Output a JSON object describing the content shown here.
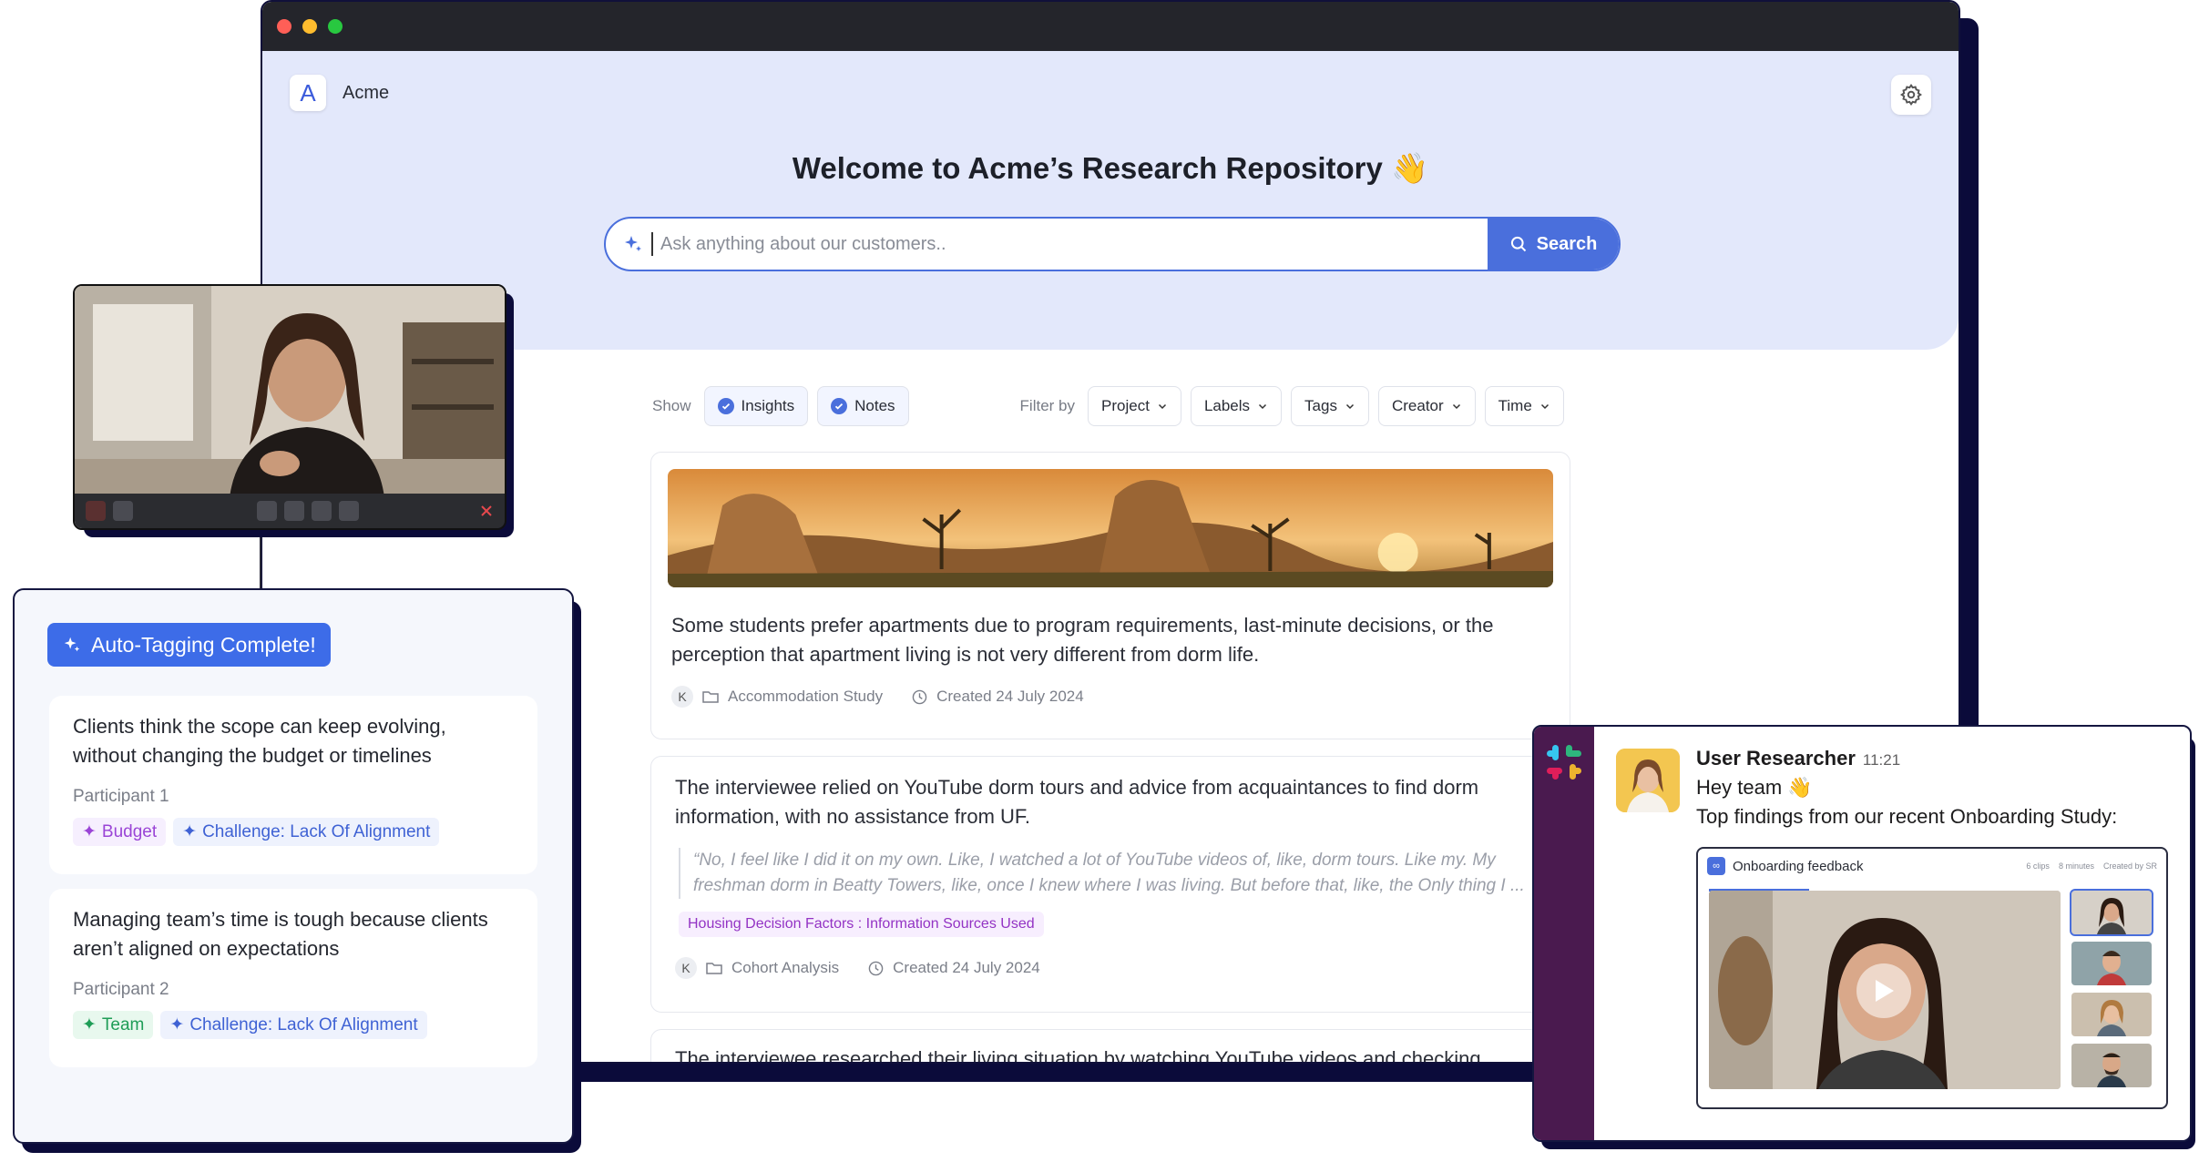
{
  "app": {
    "brand_letter": "A",
    "brand_name": "Acme",
    "title": "Welcome to Acme’s Research Repository 👋"
  },
  "search": {
    "placeholder": "Ask anything about our customers..",
    "button_label": "Search"
  },
  "filters": {
    "show_label": "Show",
    "show_options": [
      {
        "label": "Insights",
        "selected": true
      },
      {
        "label": "Notes",
        "selected": true
      }
    ],
    "filter_label": "Filter by",
    "dropdowns": [
      "Project",
      "Labels",
      "Tags",
      "Creator",
      "Time"
    ]
  },
  "cards": [
    {
      "text": "Some students prefer apartments due to program requirements, last-minute decisions, or the perception that apartment living is not very different from dorm life.",
      "avatar": "K",
      "project": "Accommodation Study",
      "created": "Created 24 July 2024"
    },
    {
      "text": "The interviewee relied on YouTube dorm tours and advice from acquaintances to find dorm information, with no assistance from UF.",
      "quote": "“No, I feel like I did it on my own. Like, I watched a lot of YouTube videos of, like, dorm tours. Like my. My freshman dorm in Beatty Towers, like, once I knew where I was living. But before that, like, the Only thing I ...",
      "tag": "Housing Decision Factors : Information Sources Used",
      "avatar": "K",
      "project": "Cohort Analysis",
      "created": "Created 24 July 2024"
    },
    {
      "text": "The interviewee researched their living situation by watching YouTube videos and checking"
    }
  ],
  "auto_tagging": {
    "badge": "Auto-Tagging Complete!",
    "items": [
      {
        "text": "Clients think the scope can keep evolving, without changing the budget or timelines",
        "participant": "Participant 1",
        "tags": [
          {
            "label": "Budget",
            "color": "purple"
          },
          {
            "label": "Challenge: Lack Of Alignment",
            "color": "blue"
          }
        ]
      },
      {
        "text": "Managing team’s time is tough because clients aren’t aligned on expectations",
        "participant": "Participant 2",
        "tags": [
          {
            "label": "Team",
            "color": "green"
          },
          {
            "label": "Challenge: Lack Of Alignment",
            "color": "blue"
          }
        ]
      }
    ]
  },
  "slack": {
    "user": "User Researcher",
    "time": "11:21",
    "line1": "Hey team 👋",
    "line2": "Top findings from our recent Onboarding Study:",
    "embed": {
      "logo": "∞",
      "title": "Onboarding feedback",
      "meta": [
        "6 clips",
        "8 minutes",
        "Created by SR"
      ]
    }
  },
  "colors": {
    "accent": "#4a6fdc",
    "hero_bg": "#e3e8fb",
    "slack_sidebar": "#4a1a4f",
    "frame": "#0b0b3a"
  }
}
